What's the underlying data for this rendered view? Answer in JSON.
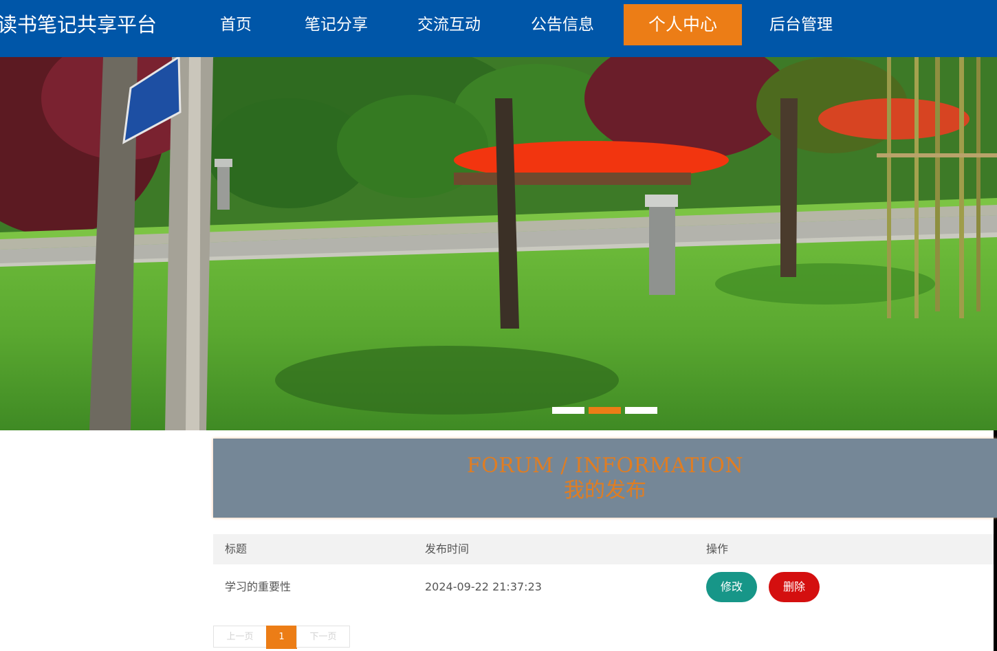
{
  "nav": {
    "brand": "读书笔记共享平台",
    "items": [
      {
        "label": "首页"
      },
      {
        "label": "笔记分享"
      },
      {
        "label": "交流互动"
      },
      {
        "label": "公告信息"
      },
      {
        "label": "个人中心",
        "active": true
      },
      {
        "label": "后台管理"
      }
    ]
  },
  "carousel": {
    "slide_count": 3,
    "active_index": 1
  },
  "section": {
    "title_en": "FORUM / INFORMATION",
    "title_cn": "我的发布"
  },
  "table": {
    "headers": [
      "标题",
      "发布时间",
      "操作"
    ],
    "rows": [
      {
        "title": "学习的重要性",
        "time": "2024-09-22 21:37:23",
        "edit_label": "修改",
        "delete_label": "删除"
      }
    ]
  },
  "pagination": {
    "prev_label": "上一页",
    "current": "1",
    "next_label": "下一页"
  },
  "colors": {
    "nav_bg": "#0056a8",
    "accent": "#ec7d16",
    "section_bg": "#758797",
    "edit_button": "#179688",
    "delete_button": "#d40f0f"
  }
}
